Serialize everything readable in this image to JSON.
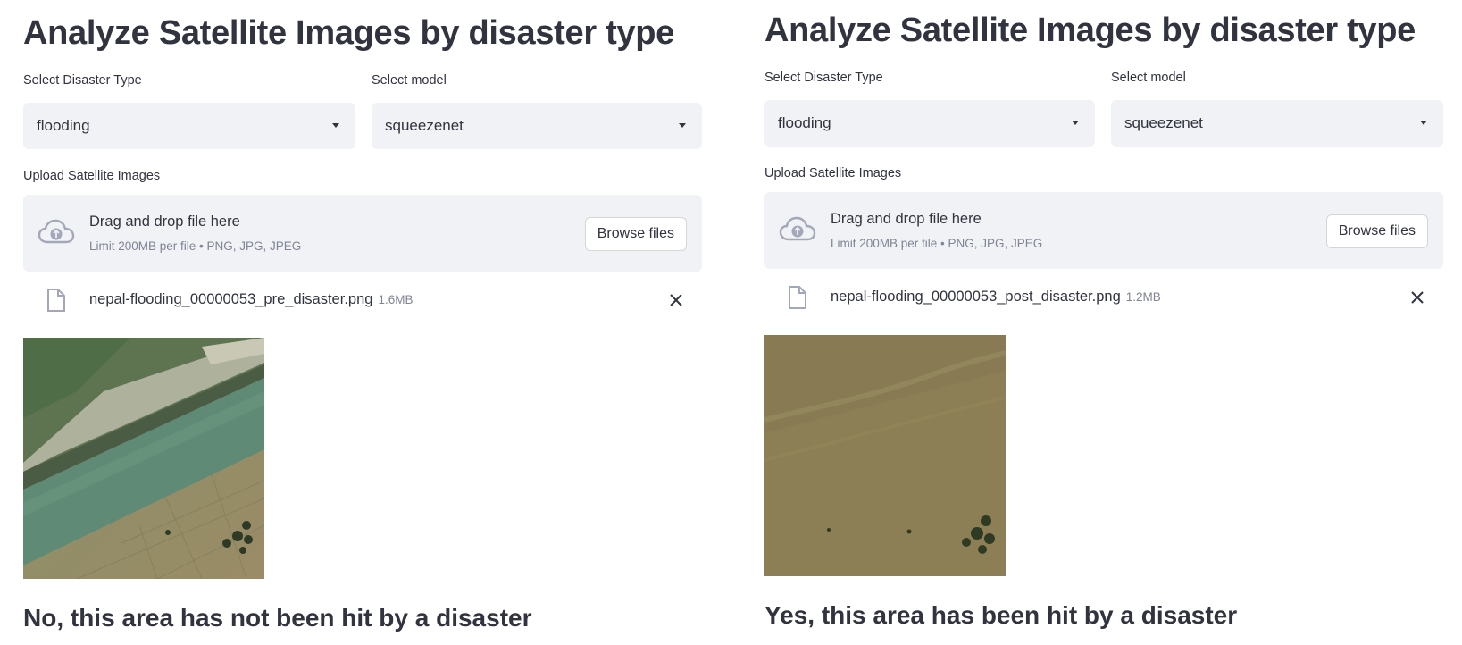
{
  "panels": [
    {
      "title": "Analyze Satellite Images by disaster type",
      "disaster_label": "Select Disaster Type",
      "disaster_value": "flooding",
      "model_label": "Select model",
      "model_value": "squeezenet",
      "upload_label": "Upload Satellite Images",
      "dropzone_title": "Drag and drop file here",
      "dropzone_sub": "Limit 200MB per file • PNG, JPG, JPEG",
      "browse_label": "Browse files",
      "file_name": "nepal-flooding_00000053_pre_disaster.png",
      "file_size": "1.6MB",
      "result": "No, this area has not been hit by a disaster"
    },
    {
      "title": "Analyze Satellite Images by disaster type",
      "disaster_label": "Select Disaster Type",
      "disaster_value": "flooding",
      "model_label": "Select model",
      "model_value": "squeezenet",
      "upload_label": "Upload Satellite Images",
      "dropzone_title": "Drag and drop file here",
      "dropzone_sub": "Limit 200MB per file • PNG, JPG, JPEG",
      "browse_label": "Browse files",
      "file_name": "nepal-flooding_00000053_post_disaster.png",
      "file_size": "1.2MB",
      "result": "Yes, this area has been hit by a disaster"
    }
  ],
  "icons": {
    "upload": "cloud-upload-icon",
    "file": "file-icon",
    "remove": "close-icon",
    "dropdown": "caret-down-icon"
  },
  "colors": {
    "text": "#31333f",
    "muted": "#808495",
    "input_bg": "#f0f2f6",
    "icon": "#a3a8b8"
  }
}
